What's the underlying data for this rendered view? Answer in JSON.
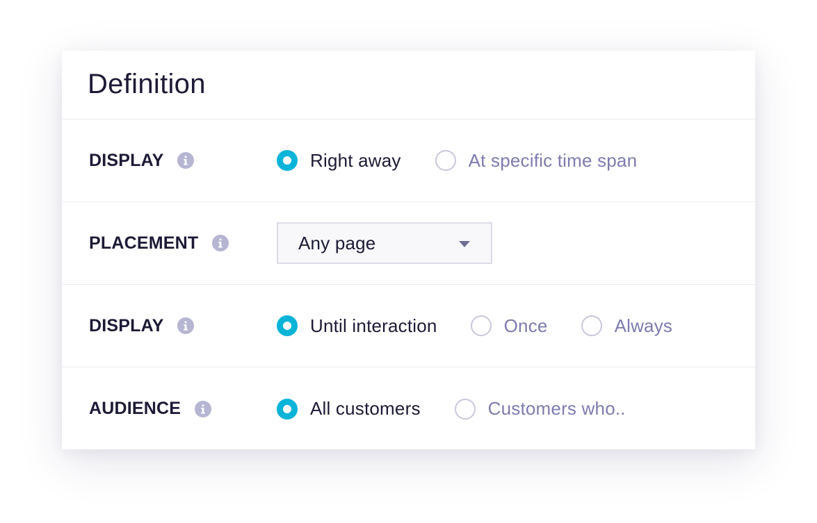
{
  "card": {
    "title": "Definition"
  },
  "rows": [
    {
      "label": "DISPLAY",
      "options": [
        {
          "label": "Right away",
          "checked": true
        },
        {
          "label": "At specific time span",
          "checked": false
        }
      ]
    },
    {
      "label": "PLACEMENT",
      "select": {
        "value": "Any page"
      }
    },
    {
      "label": "DISPLAY",
      "options": [
        {
          "label": "Until interaction",
          "checked": true
        },
        {
          "label": "Once",
          "checked": false
        },
        {
          "label": "Always",
          "checked": false
        }
      ]
    },
    {
      "label": "AUDIENCE",
      "options": [
        {
          "label": "All customers",
          "checked": true
        },
        {
          "label": "Customers who..",
          "checked": false
        }
      ]
    }
  ],
  "icons": {
    "info": "info-icon",
    "dropdown": "caret-down-icon"
  },
  "colors": {
    "accent": "#0ab4d8",
    "text_dark": "#1c1a35",
    "text_muted": "#7d7bae",
    "info_icon": "#b6b5d2",
    "divider": "#ececf2"
  }
}
